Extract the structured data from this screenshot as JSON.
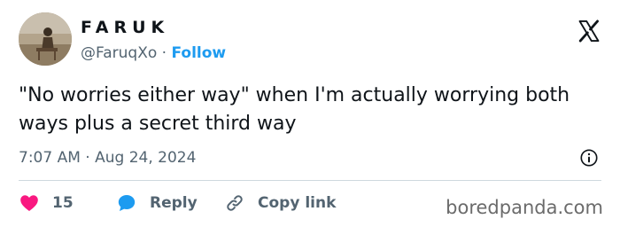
{
  "user": {
    "display_name": "FARUK",
    "handle": "@FaruqXo",
    "separator": "·",
    "follow_label": "Follow"
  },
  "tweet": {
    "text": "\"No worries either way\" when I'm actually worrying both ways plus a secret third way",
    "time": "7:07 AM",
    "date_separator": "·",
    "date": "Aug 24, 2024"
  },
  "actions": {
    "likes_count": "15",
    "reply_label": "Reply",
    "copy_link_label": "Copy link"
  },
  "watermark": "boredpanda.com",
  "icons": {
    "brand": "x-logo-icon",
    "info": "info-icon",
    "like": "heart-icon",
    "reply": "speech-bubble-icon",
    "copy": "link-icon"
  },
  "colors": {
    "text": "#0f1419",
    "muted": "#536471",
    "link": "#1d9bf0",
    "heart": "#f91880",
    "reply": "#1d9bf0",
    "divider": "#cfd9de"
  }
}
